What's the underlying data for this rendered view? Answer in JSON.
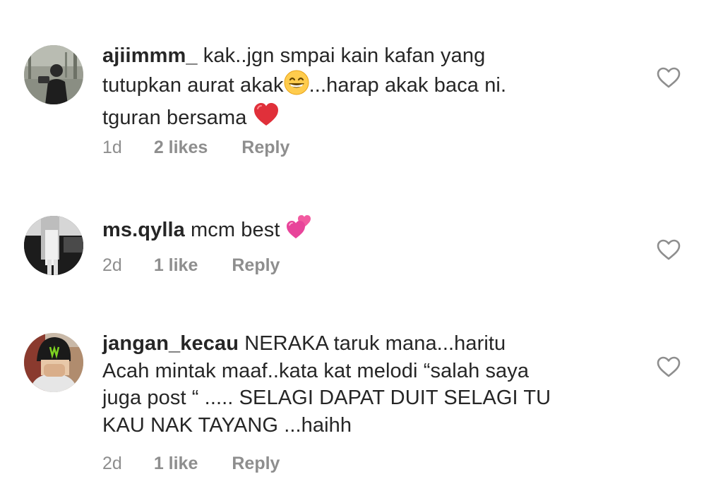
{
  "comments": [
    {
      "username": "ajiimmm_",
      "text_lines": [
        "kak..jgn smpai kain kafan yang",
        "tutupkan aurat akak",
        "...harap akak baca ni.",
        "tguran bersama"
      ],
      "emojis": [
        "grinning-face-with-smiling-eyes",
        "red-heart"
      ],
      "time": "1d",
      "likes": "2 likes",
      "reply": "Reply",
      "like_icon": "heart-outline-icon"
    },
    {
      "username": "ms.qylla",
      "text_lines": [
        "mcm best"
      ],
      "emojis": [
        "two-hearts"
      ],
      "time": "2d",
      "likes": "1 like",
      "reply": "Reply",
      "like_icon": "heart-outline-icon"
    },
    {
      "username": "jangan_kecau",
      "text_lines": [
        "NERAKA taruk mana...haritu",
        "Acah mintak maaf..kata kat melodi “salah saya",
        "juga post “ ..... SELAGI DAPAT DUIT SELAGI TU",
        "KAU NAK TAYANG ...haihh"
      ],
      "emojis": [],
      "time": "2d",
      "likes": "1 like",
      "reply": "Reply",
      "like_icon": "heart-outline-icon"
    }
  ],
  "colors": {
    "text": "#262626",
    "meta": "#8e8e8e",
    "background": "#ffffff"
  }
}
